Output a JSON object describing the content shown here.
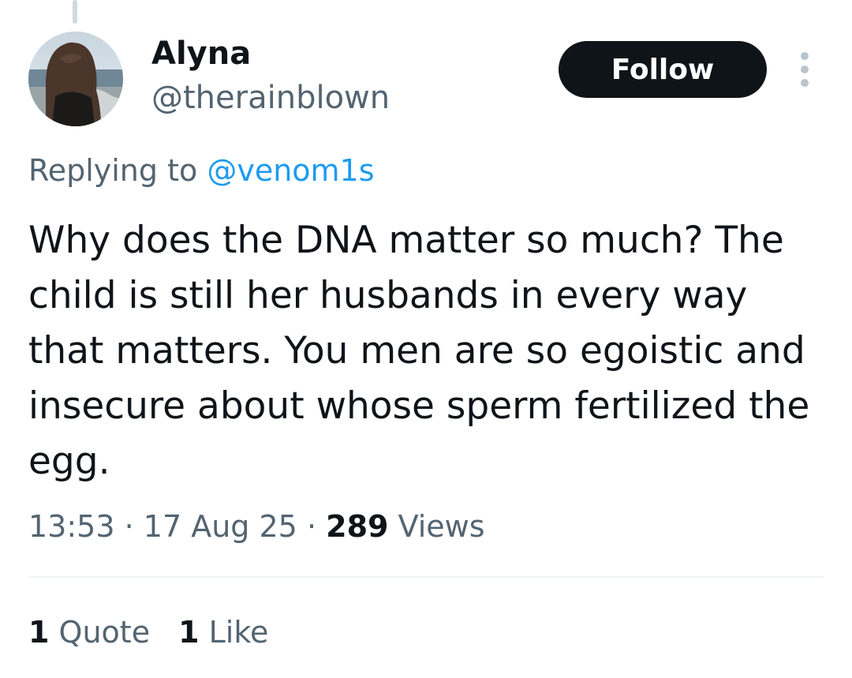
{
  "author": {
    "name": "Alyna",
    "handle": "@therainblown"
  },
  "follow_label": "Follow",
  "reply": {
    "prefix": "Replying to",
    "mention": "@venom1s"
  },
  "tweet_text": "Why does the DNA matter so much? The child is still her husbands in every way that matters. You men are so egoistic and insecure about whose sperm fertilized the egg.",
  "meta": {
    "time": "13:53",
    "date": "17 Aug 25",
    "views_count": "289",
    "views_label": "Views"
  },
  "stats": {
    "quotes_count": "1",
    "quotes_label": "Quote",
    "likes_count": "1",
    "likes_label": "Like"
  },
  "icons": {
    "more": "more-icon",
    "avatar": "avatar-image"
  }
}
